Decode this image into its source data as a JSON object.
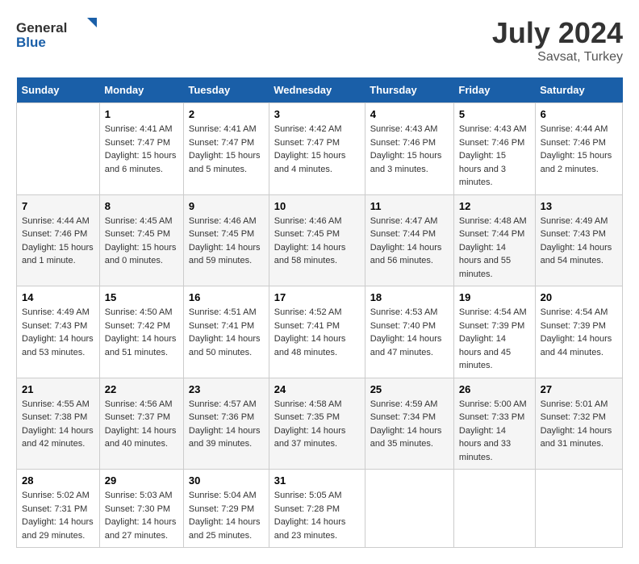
{
  "header": {
    "logo_line1": "General",
    "logo_line2": "Blue",
    "month": "July 2024",
    "location": "Savsat, Turkey"
  },
  "weekdays": [
    "Sunday",
    "Monday",
    "Tuesday",
    "Wednesday",
    "Thursday",
    "Friday",
    "Saturday"
  ],
  "weeks": [
    [
      {
        "day": "",
        "sunrise": "",
        "sunset": "",
        "daylight": ""
      },
      {
        "day": "1",
        "sunrise": "Sunrise: 4:41 AM",
        "sunset": "Sunset: 7:47 PM",
        "daylight": "Daylight: 15 hours and 6 minutes."
      },
      {
        "day": "2",
        "sunrise": "Sunrise: 4:41 AM",
        "sunset": "Sunset: 7:47 PM",
        "daylight": "Daylight: 15 hours and 5 minutes."
      },
      {
        "day": "3",
        "sunrise": "Sunrise: 4:42 AM",
        "sunset": "Sunset: 7:47 PM",
        "daylight": "Daylight: 15 hours and 4 minutes."
      },
      {
        "day": "4",
        "sunrise": "Sunrise: 4:43 AM",
        "sunset": "Sunset: 7:46 PM",
        "daylight": "Daylight: 15 hours and 3 minutes."
      },
      {
        "day": "5",
        "sunrise": "Sunrise: 4:43 AM",
        "sunset": "Sunset: 7:46 PM",
        "daylight": "Daylight: 15 hours and 3 minutes."
      },
      {
        "day": "6",
        "sunrise": "Sunrise: 4:44 AM",
        "sunset": "Sunset: 7:46 PM",
        "daylight": "Daylight: 15 hours and 2 minutes."
      }
    ],
    [
      {
        "day": "7",
        "sunrise": "Sunrise: 4:44 AM",
        "sunset": "Sunset: 7:46 PM",
        "daylight": "Daylight: 15 hours and 1 minute."
      },
      {
        "day": "8",
        "sunrise": "Sunrise: 4:45 AM",
        "sunset": "Sunset: 7:45 PM",
        "daylight": "Daylight: 15 hours and 0 minutes."
      },
      {
        "day": "9",
        "sunrise": "Sunrise: 4:46 AM",
        "sunset": "Sunset: 7:45 PM",
        "daylight": "Daylight: 14 hours and 59 minutes."
      },
      {
        "day": "10",
        "sunrise": "Sunrise: 4:46 AM",
        "sunset": "Sunset: 7:45 PM",
        "daylight": "Daylight: 14 hours and 58 minutes."
      },
      {
        "day": "11",
        "sunrise": "Sunrise: 4:47 AM",
        "sunset": "Sunset: 7:44 PM",
        "daylight": "Daylight: 14 hours and 56 minutes."
      },
      {
        "day": "12",
        "sunrise": "Sunrise: 4:48 AM",
        "sunset": "Sunset: 7:44 PM",
        "daylight": "Daylight: 14 hours and 55 minutes."
      },
      {
        "day": "13",
        "sunrise": "Sunrise: 4:49 AM",
        "sunset": "Sunset: 7:43 PM",
        "daylight": "Daylight: 14 hours and 54 minutes."
      }
    ],
    [
      {
        "day": "14",
        "sunrise": "Sunrise: 4:49 AM",
        "sunset": "Sunset: 7:43 PM",
        "daylight": "Daylight: 14 hours and 53 minutes."
      },
      {
        "day": "15",
        "sunrise": "Sunrise: 4:50 AM",
        "sunset": "Sunset: 7:42 PM",
        "daylight": "Daylight: 14 hours and 51 minutes."
      },
      {
        "day": "16",
        "sunrise": "Sunrise: 4:51 AM",
        "sunset": "Sunset: 7:41 PM",
        "daylight": "Daylight: 14 hours and 50 minutes."
      },
      {
        "day": "17",
        "sunrise": "Sunrise: 4:52 AM",
        "sunset": "Sunset: 7:41 PM",
        "daylight": "Daylight: 14 hours and 48 minutes."
      },
      {
        "day": "18",
        "sunrise": "Sunrise: 4:53 AM",
        "sunset": "Sunset: 7:40 PM",
        "daylight": "Daylight: 14 hours and 47 minutes."
      },
      {
        "day": "19",
        "sunrise": "Sunrise: 4:54 AM",
        "sunset": "Sunset: 7:39 PM",
        "daylight": "Daylight: 14 hours and 45 minutes."
      },
      {
        "day": "20",
        "sunrise": "Sunrise: 4:54 AM",
        "sunset": "Sunset: 7:39 PM",
        "daylight": "Daylight: 14 hours and 44 minutes."
      }
    ],
    [
      {
        "day": "21",
        "sunrise": "Sunrise: 4:55 AM",
        "sunset": "Sunset: 7:38 PM",
        "daylight": "Daylight: 14 hours and 42 minutes."
      },
      {
        "day": "22",
        "sunrise": "Sunrise: 4:56 AM",
        "sunset": "Sunset: 7:37 PM",
        "daylight": "Daylight: 14 hours and 40 minutes."
      },
      {
        "day": "23",
        "sunrise": "Sunrise: 4:57 AM",
        "sunset": "Sunset: 7:36 PM",
        "daylight": "Daylight: 14 hours and 39 minutes."
      },
      {
        "day": "24",
        "sunrise": "Sunrise: 4:58 AM",
        "sunset": "Sunset: 7:35 PM",
        "daylight": "Daylight: 14 hours and 37 minutes."
      },
      {
        "day": "25",
        "sunrise": "Sunrise: 4:59 AM",
        "sunset": "Sunset: 7:34 PM",
        "daylight": "Daylight: 14 hours and 35 minutes."
      },
      {
        "day": "26",
        "sunrise": "Sunrise: 5:00 AM",
        "sunset": "Sunset: 7:33 PM",
        "daylight": "Daylight: 14 hours and 33 minutes."
      },
      {
        "day": "27",
        "sunrise": "Sunrise: 5:01 AM",
        "sunset": "Sunset: 7:32 PM",
        "daylight": "Daylight: 14 hours and 31 minutes."
      }
    ],
    [
      {
        "day": "28",
        "sunrise": "Sunrise: 5:02 AM",
        "sunset": "Sunset: 7:31 PM",
        "daylight": "Daylight: 14 hours and 29 minutes."
      },
      {
        "day": "29",
        "sunrise": "Sunrise: 5:03 AM",
        "sunset": "Sunset: 7:30 PM",
        "daylight": "Daylight: 14 hours and 27 minutes."
      },
      {
        "day": "30",
        "sunrise": "Sunrise: 5:04 AM",
        "sunset": "Sunset: 7:29 PM",
        "daylight": "Daylight: 14 hours and 25 minutes."
      },
      {
        "day": "31",
        "sunrise": "Sunrise: 5:05 AM",
        "sunset": "Sunset: 7:28 PM",
        "daylight": "Daylight: 14 hours and 23 minutes."
      },
      {
        "day": "",
        "sunrise": "",
        "sunset": "",
        "daylight": ""
      },
      {
        "day": "",
        "sunrise": "",
        "sunset": "",
        "daylight": ""
      },
      {
        "day": "",
        "sunrise": "",
        "sunset": "",
        "daylight": ""
      }
    ]
  ]
}
